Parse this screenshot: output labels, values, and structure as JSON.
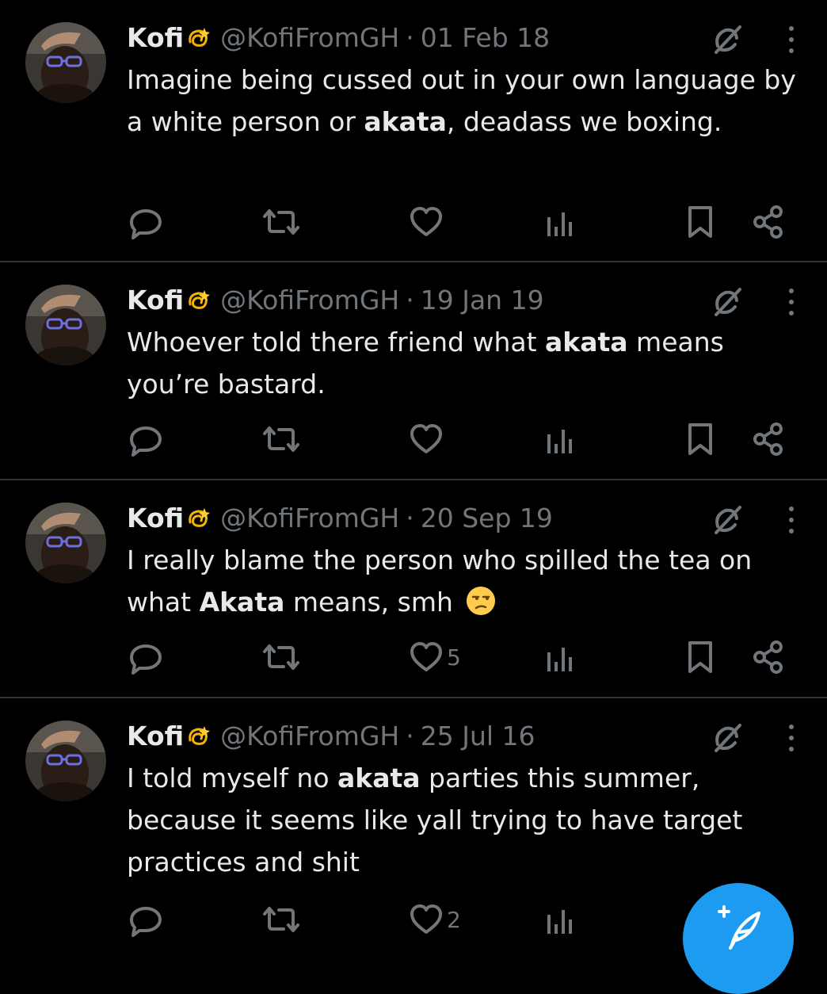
{
  "colors": {
    "background": "#000000",
    "text": "#e7e9ea",
    "muted": "#71767b",
    "divider": "#2f3336",
    "accent": "#1d9bf0"
  },
  "tweets": [
    {
      "name": "Kofi",
      "badge_icon": "dizzy-emoji",
      "handle": "@KofiFromGH",
      "separator": "·",
      "date": "01 Feb 18",
      "text_segments": [
        {
          "t": "Imagine being cussed out in your own language by a white person or ",
          "bold": false
        },
        {
          "t": "akata",
          "bold": true
        },
        {
          "t": ", deadass we boxing.",
          "bold": false
        }
      ],
      "likes": ""
    },
    {
      "name": "Kofi",
      "badge_icon": "dizzy-emoji",
      "handle": "@KofiFromGH",
      "separator": "·",
      "date": "19 Jan 19",
      "text_segments": [
        {
          "t": "Whoever told there friend what ",
          "bold": false
        },
        {
          "t": "akata",
          "bold": true
        },
        {
          "t": " means you’re bastard.",
          "bold": false
        }
      ],
      "likes": ""
    },
    {
      "name": "Kofi",
      "badge_icon": "dizzy-emoji",
      "handle": "@KofiFromGH",
      "separator": "·",
      "date": "20 Sep 19",
      "text_segments": [
        {
          "t": "I really blame the person who spilled the tea on what ",
          "bold": false
        },
        {
          "t": "Akata",
          "bold": true
        },
        {
          "t": " means, smh ",
          "bold": false
        }
      ],
      "trailing_emoji": "unamused-face-emoji",
      "likes": "5"
    },
    {
      "name": "Kofi",
      "badge_icon": "dizzy-emoji",
      "handle": "@KofiFromGH",
      "separator": "·",
      "date": "25 Jul 16",
      "text_segments": [
        {
          "t": "I told myself no ",
          "bold": false
        },
        {
          "t": "akata",
          "bold": true
        },
        {
          "t": " parties this summer, because it seems like yall trying to have target practices and shit",
          "bold": false
        }
      ],
      "likes": "2"
    }
  ],
  "action_icons": [
    "reply-icon",
    "retweet-icon",
    "like-icon",
    "views-icon",
    "bookmark-icon",
    "share-icon"
  ],
  "header_icons": [
    "grok-icon",
    "more-options-icon"
  ],
  "fab": {
    "icon": "compose-tweet-icon"
  }
}
